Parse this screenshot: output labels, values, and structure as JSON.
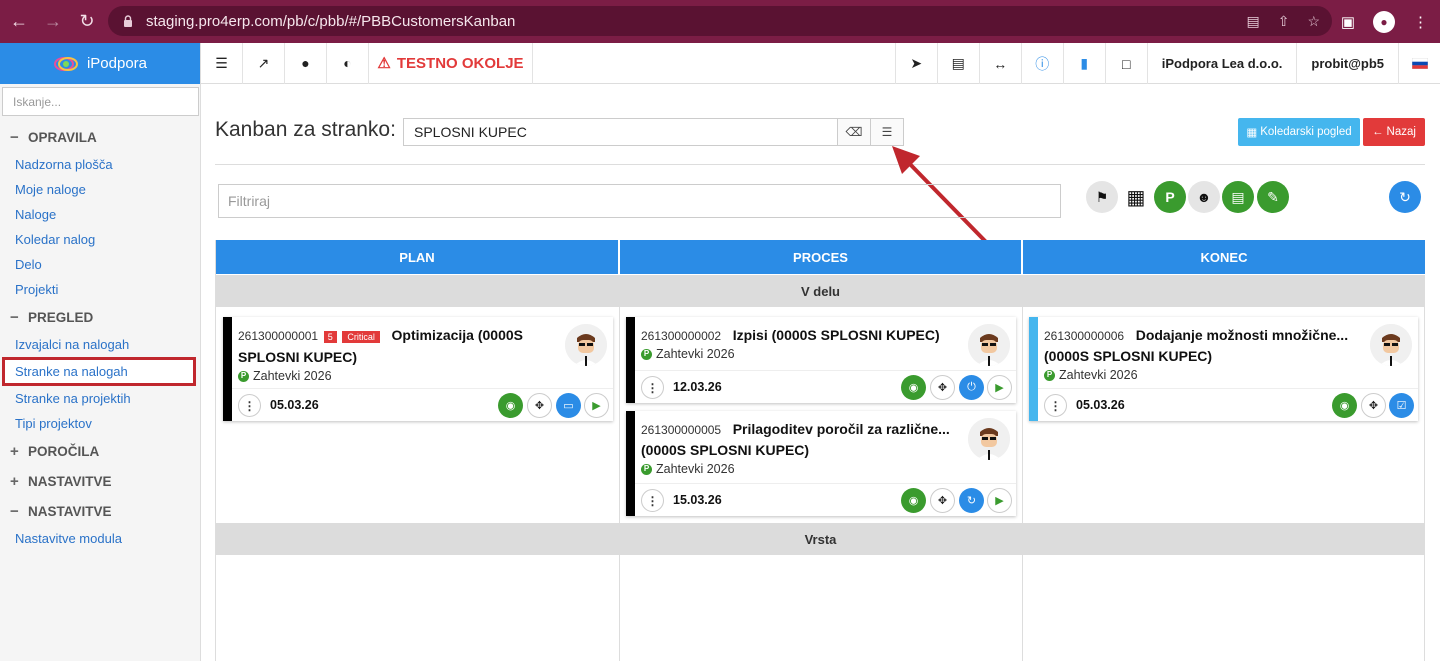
{
  "browser": {
    "url": "staging.pro4erp.com/pb/c/pbb/#/PBBCustomersKanban"
  },
  "sidebar": {
    "brand": "iPodpora",
    "search_placeholder": "Iskanje...",
    "sections": [
      {
        "title": "OPRAVILA",
        "sym": "−",
        "items": [
          "Nadzorna plošča",
          "Moje naloge",
          "Naloge",
          "Koledar nalog",
          "Delo",
          "Projekti"
        ]
      },
      {
        "title": "PREGLED",
        "sym": "−",
        "items": [
          "Izvajalci na nalogah",
          "Stranke na nalogah",
          "Stranke na projektih",
          "Tipi projektov"
        ]
      },
      {
        "title": "POROČILA",
        "sym": "+",
        "items": []
      },
      {
        "title": "NASTAVITVE",
        "sym": "+",
        "items": []
      },
      {
        "title": "NASTAVITVE",
        "sym": "−",
        "items": [
          "Nastavitve modula"
        ]
      }
    ]
  },
  "topbar": {
    "env_warning": "TESTNO OKOLJE",
    "company": "iPodpora Lea d.o.o.",
    "user": "probit@pb5"
  },
  "main": {
    "title": "Kanban za stranko:",
    "customer_value": "SPLOSNI KUPEC",
    "calendar_btn": "Koledarski pogled",
    "back_btn": "Nazaj",
    "filter_placeholder": "Filtriraj"
  },
  "board": {
    "columns": [
      "PLAN",
      "PROCES",
      "KONEC"
    ],
    "lanes": [
      "V delu",
      "Vrsta"
    ],
    "cards": {
      "c1": {
        "id": "261300000001",
        "num_badge": "5",
        "prio_badge": "Critical",
        "title": "Optimizacija (0000S",
        "title2": "SPLOSNI KUPEC)",
        "project": "Zahtevki 2026",
        "date": "05.03.26"
      },
      "c2": {
        "id": "261300000002",
        "title": "Izpisi (0000S SPLOSNI KUPEC)",
        "project": "Zahtevki 2026",
        "date": "12.03.26"
      },
      "c3": {
        "id": "261300000005",
        "title": "Prilagoditev poročil za različne...",
        "title2": "(0000S SPLOSNI KUPEC)",
        "project": "Zahtevki 2026",
        "date": "15.03.26"
      },
      "c4": {
        "id": "261300000006",
        "title": "Dodajanje možnosti množične...",
        "title2": "(0000S SPLOSNI KUPEC)",
        "project": "Zahtevki 2026",
        "date": "05.03.26"
      }
    }
  },
  "colors": {
    "accent_blue": "#2b8ce6",
    "green": "#3a9b2e",
    "red": "#e23a3a",
    "chrome": "#7b1d45"
  }
}
